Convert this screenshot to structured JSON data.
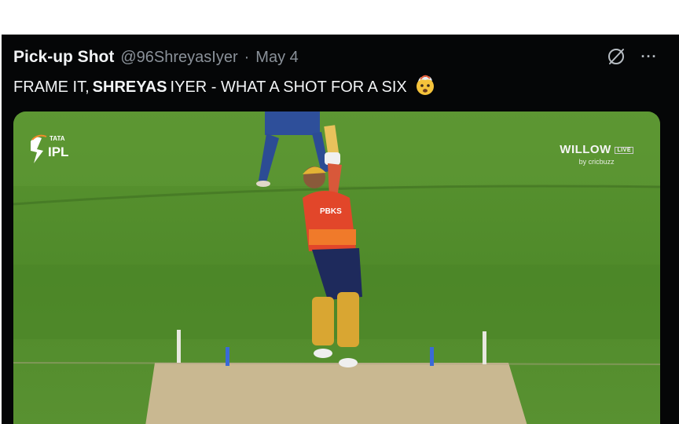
{
  "tweet": {
    "author_name": "Pick-up Shot",
    "author_handle": "@96ShreyasIyer",
    "separator": "·",
    "date": "May 4",
    "text_prefix": "FRAME IT,",
    "text_bold": "SHREYAS",
    "text_suffix": "IYER - WHAT A SHOT FOR A SIX",
    "emoji_icon": "exploding-head-emoji",
    "actions": [
      {
        "icon": "grok-icon"
      },
      {
        "icon": "more-icon",
        "label": "···"
      }
    ]
  },
  "media": {
    "logo": {
      "brand": "TATA",
      "name": "IPL"
    },
    "broadcaster": {
      "title": "WILLOW",
      "badge": "LIVE",
      "sub": "by cricbuzz"
    },
    "jersey_text": "PBKS"
  },
  "colors": {
    "background": "#050607",
    "pitch": "#4f8a2a",
    "jersey": "#e2462a"
  }
}
